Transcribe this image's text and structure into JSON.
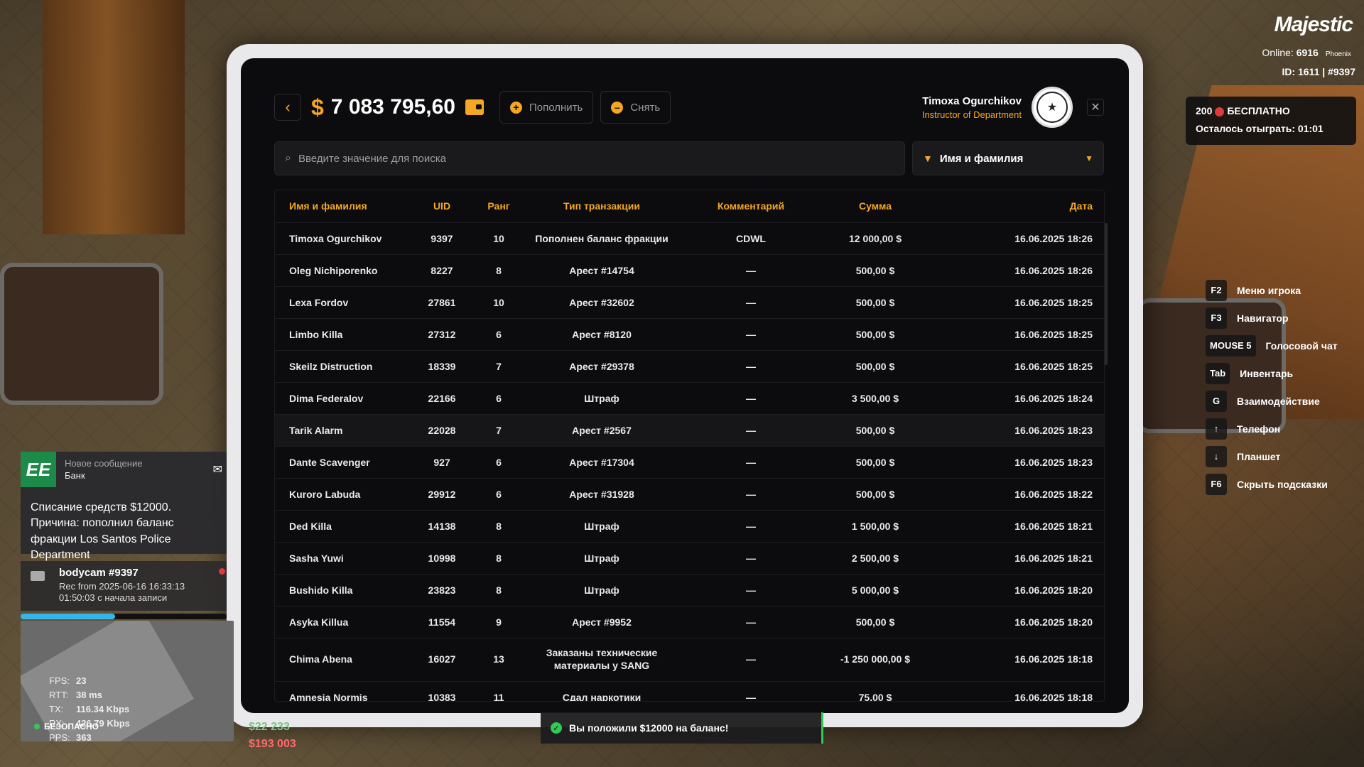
{
  "hud": {
    "logo": "Majestic",
    "online_label": "Online:",
    "online_count": "6916",
    "server": "Phoenix",
    "id_line": "ID: 1611 | #9397",
    "promo_count": "200",
    "promo_free": "БЕСПЛАТНО",
    "promo_remaining": "Осталось отыграть:",
    "promo_time": "01:01"
  },
  "hints": [
    {
      "key": "F2",
      "label": "Меню игрока"
    },
    {
      "key": "F3",
      "label": "Навигатор"
    },
    {
      "key": "MOUSE 5",
      "label": "Голосовой чат"
    },
    {
      "key": "Tab",
      "label": "Инвентарь"
    },
    {
      "key": "G",
      "label": "Взаимодействие"
    },
    {
      "key": "↑",
      "label": "Телефон"
    },
    {
      "key": "↓",
      "label": "Планшет"
    },
    {
      "key": "F6",
      "label": "Скрыть подсказки"
    }
  ],
  "tablet": {
    "balance_symbol": "$",
    "balance": "7 083 795,60",
    "deposit_label": "Пополнить",
    "withdraw_label": "Снять",
    "profile_name": "Timoxa Ogurchikov",
    "profile_role": "Instructor of Department",
    "search_placeholder": "Введите значение для поиска",
    "filter_label": "Имя и фамилия"
  },
  "table": {
    "headers": [
      "Имя и фамилия",
      "UID",
      "Ранг",
      "Тип транзакции",
      "Комментарий",
      "Сумма",
      "Дата"
    ],
    "rows": [
      [
        "Timoxa Ogurchikov",
        "9397",
        "10",
        "Пополнен баланс фракции",
        "CDWL",
        "12 000,00 $",
        "16.06.2025 18:26"
      ],
      [
        "Oleg Nichiporenko",
        "8227",
        "8",
        "Арест #14754",
        "—",
        "500,00 $",
        "16.06.2025 18:26"
      ],
      [
        "Lexa Fordov",
        "27861",
        "10",
        "Арест #32602",
        "—",
        "500,00 $",
        "16.06.2025 18:25"
      ],
      [
        "Limbo Killa",
        "27312",
        "6",
        "Арест #8120",
        "—",
        "500,00 $",
        "16.06.2025 18:25"
      ],
      [
        "Skeilz Distruction",
        "18339",
        "7",
        "Арест #29378",
        "—",
        "500,00 $",
        "16.06.2025 18:25"
      ],
      [
        "Dima Federalov",
        "22166",
        "6",
        "Штраф",
        "—",
        "3 500,00 $",
        "16.06.2025 18:24"
      ],
      [
        "Tarik Alarm",
        "22028",
        "7",
        "Арест #2567",
        "—",
        "500,00 $",
        "16.06.2025 18:23"
      ],
      [
        "Dante Scavenger",
        "927",
        "6",
        "Арест #17304",
        "—",
        "500,00 $",
        "16.06.2025 18:23"
      ],
      [
        "Kuroro Labuda",
        "29912",
        "6",
        "Арест #31928",
        "—",
        "500,00 $",
        "16.06.2025 18:22"
      ],
      [
        "Ded Killa",
        "14138",
        "8",
        "Штраф",
        "—",
        "1 500,00 $",
        "16.06.2025 18:21"
      ],
      [
        "Sasha Yuwi",
        "10998",
        "8",
        "Штраф",
        "—",
        "2 500,00 $",
        "16.06.2025 18:21"
      ],
      [
        "Bushido Killa",
        "23823",
        "8",
        "Штраф",
        "—",
        "5 000,00 $",
        "16.06.2025 18:20"
      ],
      [
        "Asyka Killua",
        "11554",
        "9",
        "Арест #9952",
        "—",
        "500,00 $",
        "16.06.2025 18:20"
      ],
      [
        "Chima Abena",
        "16027",
        "13",
        "Заказаны технические материалы у SANG",
        "—",
        "-1 250 000,00 $",
        "16.06.2025 18:18"
      ],
      [
        "Amnesia Normis",
        "10383",
        "11",
        "Сдал наркотики",
        "—",
        "75,00 $",
        "16.06.2025 18:18"
      ]
    ]
  },
  "notification": {
    "logo": "EE",
    "title": "Новое сообщение",
    "sender": "Банк",
    "body": "Списание средств $12000. Причина: пополнил баланс фракции Los Santos Police Department"
  },
  "bodycam": {
    "title": "bodycam #9397",
    "rec_from": "Rec from 2025-06-16 16:33:13",
    "elapsed": "01:50:03 с начала записи"
  },
  "stream_progress": 0.46,
  "netstats": {
    "fps_label": "FPS:",
    "fps": "23",
    "rtt_label": "RTT:",
    "rtt": "38 ms",
    "tx_label": "TX:",
    "tx": "116.34 Kbps",
    "rx_label": "RX:",
    "rx": "426.79 Kbps",
    "pps_label": "PPS:",
    "pps": "363",
    "zone": "БЕЗОПАСНО"
  },
  "money": {
    "cash": "$22 233",
    "bank": "$193 003"
  },
  "toast": "Вы положили $12000 на баланс!"
}
